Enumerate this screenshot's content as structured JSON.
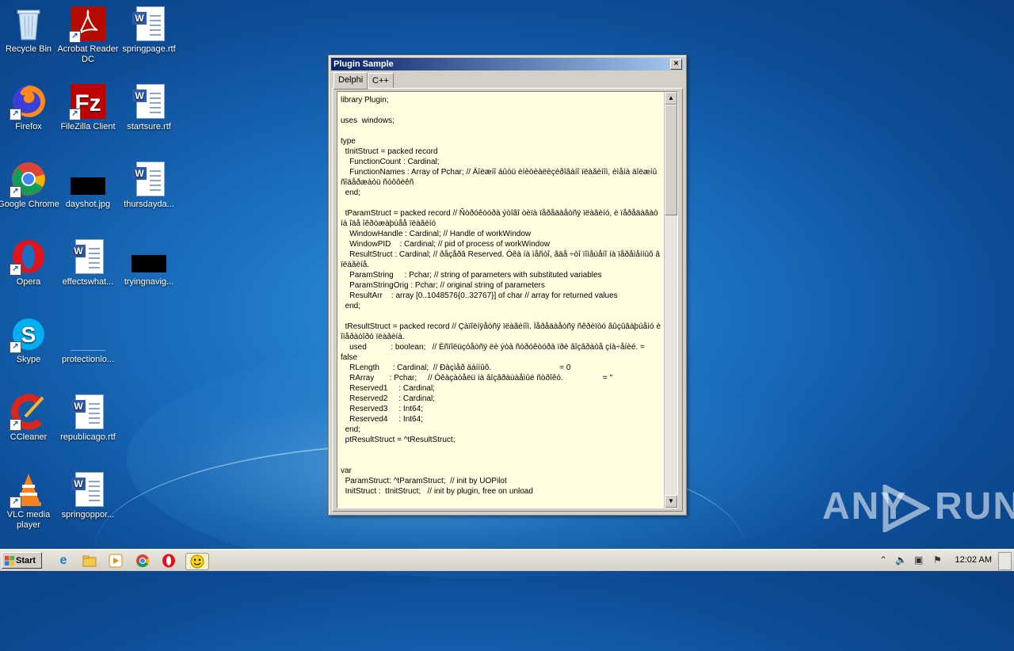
{
  "desktop": {
    "icons": [
      {
        "label": "Recycle Bin",
        "icon": "recycle-bin-icon"
      },
      {
        "label": "Acrobat Reader DC",
        "icon": "acrobat-icon"
      },
      {
        "label": "springpage.rtf",
        "icon": "word-doc-icon"
      },
      {
        "label": "Firefox",
        "icon": "firefox-icon"
      },
      {
        "label": "FileZilla Client",
        "icon": "filezilla-icon"
      },
      {
        "label": "startsure.rtf",
        "icon": "word-doc-icon"
      },
      {
        "label": "Google Chrome",
        "icon": "chrome-icon"
      },
      {
        "label": "dayshot.jpg",
        "icon": "image-file-icon"
      },
      {
        "label": "thursdayda...",
        "icon": "word-doc-icon"
      },
      {
        "label": "Opera",
        "icon": "opera-icon"
      },
      {
        "label": "effectswhat...",
        "icon": "word-doc-icon"
      },
      {
        "label": "tryingnavig...",
        "icon": "image-file-icon"
      },
      {
        "label": "Skype",
        "icon": "skype-icon"
      },
      {
        "label": "protectionlo...",
        "icon": "generic-file-icon"
      },
      {
        "label": "CCleaner",
        "icon": "ccleaner-icon"
      },
      {
        "label": "republicago.rtf",
        "icon": "word-doc-icon"
      },
      {
        "label": "VLC media player",
        "icon": "vlc-icon"
      },
      {
        "label": "springoppor...",
        "icon": "word-doc-icon"
      }
    ]
  },
  "window": {
    "title": "Plugin Sample",
    "close_glyph": "×",
    "tabs": [
      {
        "label": "Delphi",
        "active": true
      },
      {
        "label": "C++",
        "active": false
      }
    ],
    "code": "library Plugin;\n\nuses  windows;\n\ntype\n  tInitStruct = packed record\n    FunctionCount : Cardinal;\n    FunctionNames : Array of Pchar; // Äîëæíî áûòü èíèöèàëèçèðîâàíî ïëàãèíîì, èìåíà äîëæíû ñîäåðæàòü ñóôôèêñ\n  end;\n\n  tParamStruct = packed record // Ñòðóêòóðà ýòîãî òèïà ïåðåäàåòñÿ ïëàãèíó, è ïåðåäàâàò íà îäå îêðóæàþùåå ïëàãèíó\n    WindowHandle : Cardinal; // Handle of workWindow\n    WindowPID    : Cardinal; // pid of process of workWindow\n    ResultStruct : Cardinal; // ðåçåðâ Reserved. Óêà íà ìåñòî, ãäå ÷òî ïîìåùåíî íà ïåðåìåííûõ â ïëàãèíå.\n    ParamString     : Pchar; // string of parameters with substituted variables\n    ParamStringOrig : Pchar; // original string of parameters\n    ResultArr    : array [0..1048576{0..32767}] of char // array for returned values\n  end;\n\n  tResultStruct = packed record // Çàïîëíÿåòñÿ ïëàãèíîì. Ïåðåäàåòñÿ ñêðèïòó âûçûâàþùåìó è îïåðàòîðó ïëàãèíà.\n    used           : boolean;   // Èñïîëüçóåòñÿ ëè ýòà ñòðóêòóðà ïðè âîçâðàòå çíà÷åíèé. = false\n    RLength      : Cardinal;  // Ðàçìåð äàííûõ.                               = 0\n    RArray       : Pchar;     // Óêàçàòåëü íà âîçâðàùàåìûé ñòðîêó.                  = ''\n    Reserved1     : Cardinal;\n    Reserved2     : Cardinal;\n    Reserved3     : Int64;\n    Reserved4     : Int64;\n  end;\n  ptResultStruct = ^tResultStruct;\n\n\nvar\n  ParamStruct: ^tParamStruct;  // init by UOPilot\n  InitStruct :  tInitStruct;   // init by plugin, free on unload"
  },
  "taskbar": {
    "start_label": "Start",
    "pinned": [
      "ie-icon",
      "explorer-icon",
      "media-player-icon",
      "chrome-icon",
      "opera-icon",
      "smiley-app-icon"
    ],
    "clock": "12:02 AM"
  },
  "watermark": {
    "left": "ANY",
    "right": "RUN"
  }
}
